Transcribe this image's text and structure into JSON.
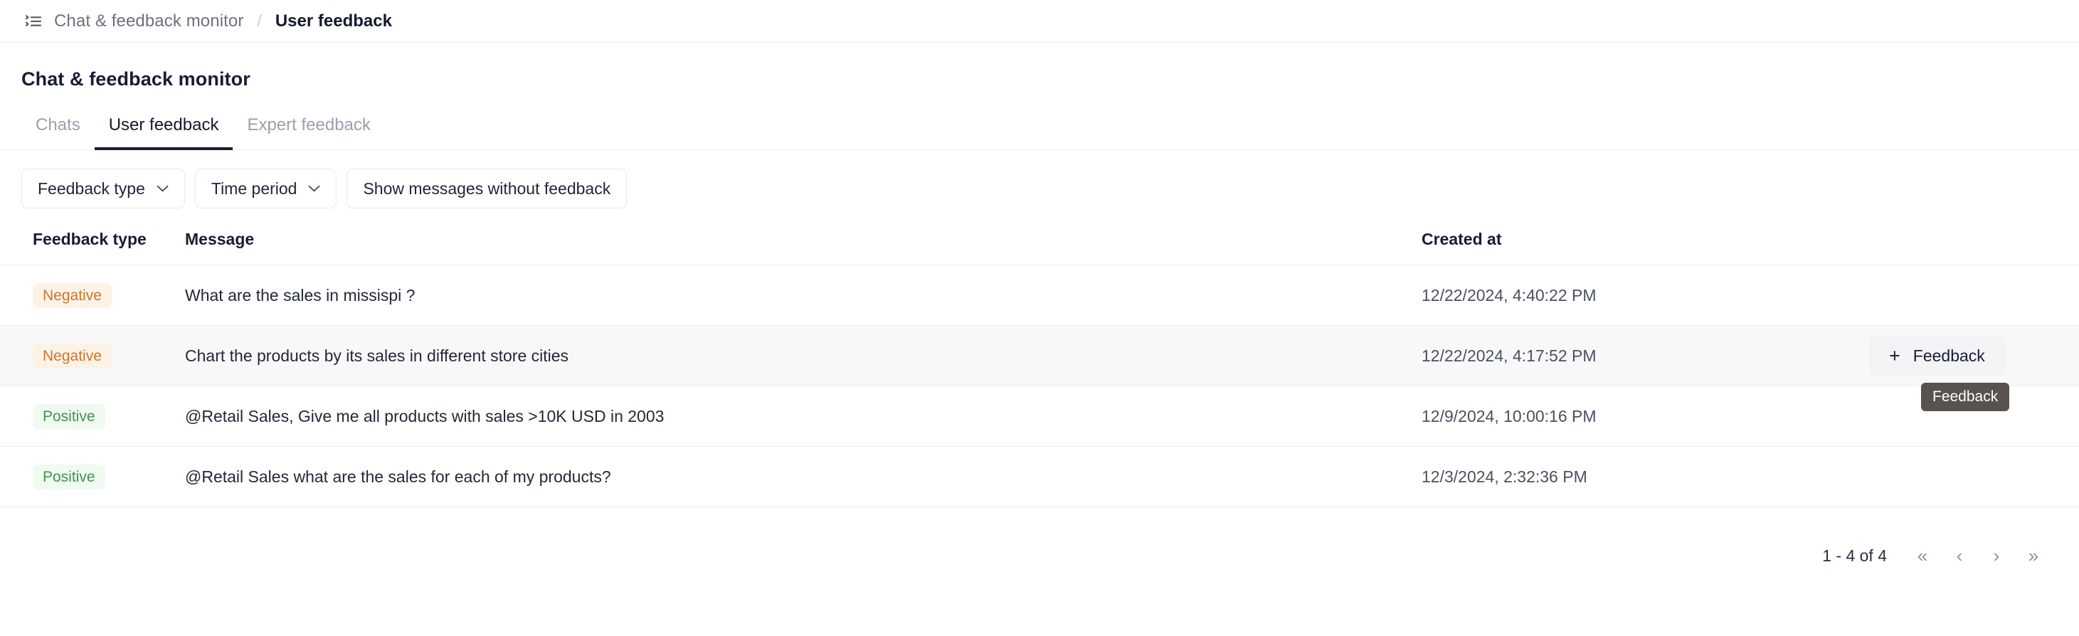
{
  "breadcrumb": {
    "menu_icon": "list-menu-icon",
    "parent": "Chat & feedback monitor",
    "separator": "/",
    "current": "User feedback"
  },
  "page": {
    "title": "Chat & feedback monitor"
  },
  "tabs": [
    {
      "label": "Chats",
      "active": false
    },
    {
      "label": "User feedback",
      "active": true
    },
    {
      "label": "Expert feedback",
      "active": false
    }
  ],
  "filters": [
    {
      "label": "Feedback type",
      "has_chevron": true
    },
    {
      "label": "Time period",
      "has_chevron": true
    },
    {
      "label": "Show messages without feedback",
      "has_chevron": false
    }
  ],
  "table": {
    "columns": [
      "Feedback type",
      "Message",
      "Created at",
      ""
    ],
    "rows": [
      {
        "feedback_type": "Negative",
        "message": "What are the sales in missispi ?",
        "created_at": "12/22/2024, 4:40:22 PM",
        "action": "",
        "hovered": false
      },
      {
        "feedback_type": "Negative",
        "message": "Chart the products by its sales in different store cities",
        "created_at": "12/22/2024, 4:17:52 PM",
        "action": "Feedback",
        "action_icon": "plus-icon",
        "hovered": true
      },
      {
        "feedback_type": "Positive",
        "message": "@Retail Sales, Give me all products with sales >10K USD in 2003",
        "created_at": "12/9/2024, 10:00:16 PM",
        "action": "",
        "hovered": false
      },
      {
        "feedback_type": "Positive",
        "message": "@Retail Sales what are the sales for each of my products?",
        "created_at": "12/3/2024, 2:32:36 PM",
        "action": "",
        "hovered": false
      }
    ]
  },
  "tooltip": {
    "text": "Feedback"
  },
  "pagination": {
    "range": "1 - 4 of 4",
    "first": "«",
    "prev": "‹",
    "next": "›",
    "last": "»"
  },
  "colors": {
    "negative_text": "#c8772a",
    "negative_bg": "#fdf2e6",
    "positive_text": "#3d9450",
    "positive_bg": "#f0faf1",
    "tab_active": "#171d33",
    "tooltip_bg": "#59524f",
    "row_hover_bg": "#f8f8f9"
  }
}
